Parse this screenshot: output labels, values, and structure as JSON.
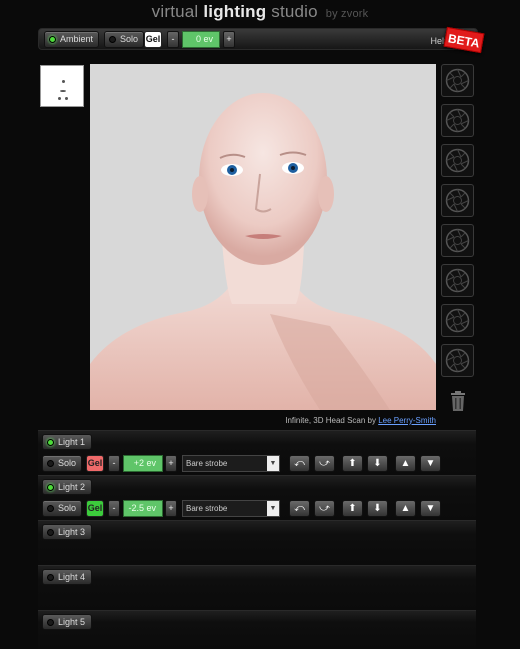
{
  "header": {
    "title_part1": "virtual",
    "title_part2": "lighting",
    "title_part3": "studio",
    "by_line": "by zvork"
  },
  "toolbar": {
    "ambient_label": "Ambient",
    "solo_label": "Solo",
    "gel_label": "Gel",
    "minus": "-",
    "plus": "+",
    "ev_value": "0 ev",
    "help_label": "Help",
    "beta_label": "BETA"
  },
  "caption": {
    "text": "Infinite, 3D Head Scan by",
    "link": "Lee Perry-Smith"
  },
  "lights": [
    {
      "label": "Light 1",
      "solo": "Solo",
      "gel": "Gel",
      "gel_color": "#f06a6a",
      "ev": "+2 ev",
      "modifier": "Bare strobe",
      "expanded": true
    },
    {
      "label": "Light 2",
      "solo": "Solo",
      "gel": "Gel",
      "gel_color": "#3ccc3c",
      "ev": "-2.5 ev",
      "modifier": "Bare strobe",
      "expanded": true
    },
    {
      "label": "Light 3",
      "expanded": false
    },
    {
      "label": "Light 4",
      "expanded": false
    },
    {
      "label": "Light 5",
      "expanded": false
    }
  ],
  "colors": {
    "accent_green": "#5fc569",
    "led_on": "#4ddb3a",
    "beta_red": "#e11b1b",
    "link_blue": "#6aa0ff"
  },
  "icons": {
    "arrows": [
      "move-left-icon",
      "move-right-icon",
      "move-up-icon",
      "move-down-icon",
      "raise-icon",
      "lower-icon"
    ]
  }
}
